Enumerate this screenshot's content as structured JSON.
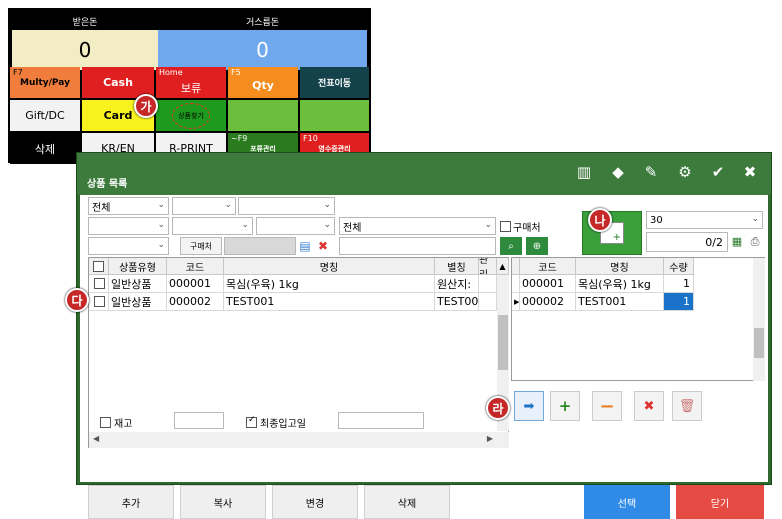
{
  "pos": {
    "received_label": "받은돈",
    "received_value": "0",
    "change_label": "거스름돈",
    "change_value": "0",
    "row1": [
      {
        "fkey": "F7",
        "label": "Multy/Pay"
      },
      {
        "fkey": "",
        "label": "Cash"
      },
      {
        "fkey": "Home",
        "label": "보류"
      },
      {
        "fkey": "F5",
        "label": "Qty"
      },
      {
        "fkey": "",
        "label": "전표이동"
      }
    ],
    "row2": [
      {
        "label": "Gift/DC"
      },
      {
        "label": "Card"
      },
      {
        "label": "상품찾기"
      },
      {
        "label": ""
      },
      {
        "label": ""
      }
    ],
    "row3": [
      {
        "label": "삭제"
      },
      {
        "label": "KR/EN"
      },
      {
        "label": "R-PRINT"
      },
      {
        "fkey": "~F9",
        "label": "포류관리"
      },
      {
        "fkey": "F10",
        "label": "영수증관리"
      }
    ]
  },
  "window": {
    "title": "상품 목록"
  },
  "filters": {
    "sel1": "전체",
    "sel_all2": "전체",
    "purchaser_btn": "구매처",
    "purchaser_chk": "구매처",
    "page_size": "30",
    "page_info": "0/2"
  },
  "left_grid": {
    "headers": [
      "상품유형",
      "코드",
      "명칭",
      "별칭",
      "관리"
    ],
    "rows": [
      {
        "type": "일반상품",
        "code": "000001",
        "name": "목심(우육) 1kg",
        "alias": "원산지:"
      },
      {
        "type": "일반상품",
        "code": "000002",
        "name": "TEST001",
        "alias": "TEST00"
      }
    ]
  },
  "right_grid": {
    "headers": [
      "코드",
      "명칭",
      "수량"
    ],
    "rows": [
      {
        "code": "000001",
        "name": "목심(우육) 1kg",
        "qty": "1"
      },
      {
        "code": "000002",
        "name": "TEST001",
        "qty": "1"
      }
    ]
  },
  "options": {
    "stock": "재고",
    "last_in": "최종입고일"
  },
  "buttons": {
    "add": "추가",
    "copy": "복사",
    "edit": "변경",
    "delete": "삭제",
    "select": "선택",
    "close": "닫기"
  },
  "badges": {
    "ga": "가",
    "na": "나",
    "da": "다",
    "ra": "라"
  }
}
